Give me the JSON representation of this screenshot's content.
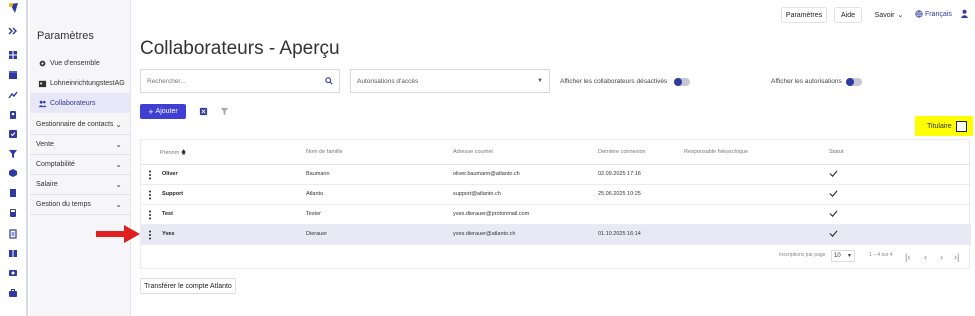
{
  "colors": {
    "accent": "#3f3fd4",
    "highlight": "#ffff00",
    "arrow": "#e02020",
    "active_row": "#e8e8f7"
  },
  "topbar": {
    "parametres": "Paramètres",
    "aide": "Aide",
    "savoir": "Savoir",
    "langue": "Français"
  },
  "sidebar": {
    "title": "Paramètres",
    "items": [
      {
        "label": "Vue d'ensemble",
        "icon": "gear-icon"
      },
      {
        "label": "LohneinrichtungstestAG",
        "icon": "building-icon"
      },
      {
        "label": "Collaborateurs",
        "icon": "users-icon"
      }
    ],
    "groups": [
      {
        "label": "Gestionnaire de contacts"
      },
      {
        "label": "Vente"
      },
      {
        "label": "Comptabilité"
      },
      {
        "label": "Salaire"
      },
      {
        "label": "Gestion du temps"
      }
    ]
  },
  "main": {
    "title": "Collaborateurs - Aperçu",
    "search_placeholder": "Rechercher...",
    "access_select": "Autorisations d'accès",
    "toggle_deactivated": "Afficher les collaborateurs désactivés",
    "toggle_permissions": "Afficher les autorisations",
    "add_button": "Ajouter",
    "titulaire": "Titulaire",
    "transfer_button": "Transférer le compte Atlanto"
  },
  "table": {
    "columns": [
      "Prénom",
      "Nom de famille",
      "Adresse courriel",
      "Dernière connexion",
      "Responsable hiérarchique",
      "Statut"
    ],
    "rows": [
      {
        "prenom": "Oliver",
        "nom": "Baumann",
        "email": "oliver.baumann@atlanto.ch",
        "last": "02.09.2025 17:16",
        "resp": "",
        "status": true
      },
      {
        "prenom": "Support",
        "nom": "Atlanto",
        "email": "support@atlanto.ch",
        "last": "25.06.2025 10:25",
        "resp": "",
        "status": true
      },
      {
        "prenom": "Test",
        "nom": "Tester",
        "email": "yves.dierauer@protonmail.com",
        "last": "",
        "resp": "",
        "status": true
      },
      {
        "prenom": "Yves",
        "nom": "Dierauer",
        "email": "yves.dierauer@atlanto.ch",
        "last": "01.10.2025 16:14",
        "resp": "",
        "status": true
      }
    ],
    "pager": {
      "label": "Inscriptions par page",
      "per_page": "10",
      "range": "1 – 4 sur 4"
    }
  }
}
